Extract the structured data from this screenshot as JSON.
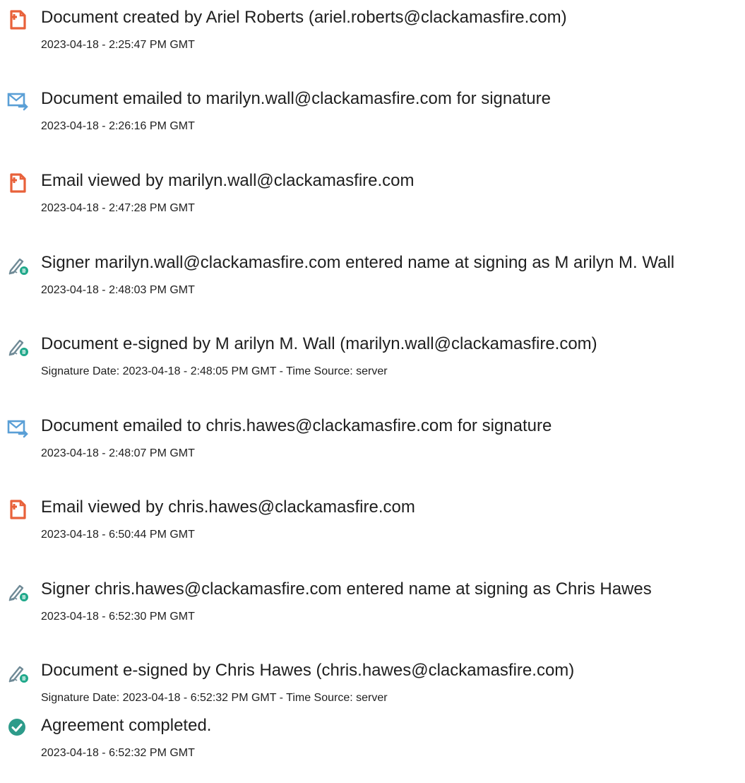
{
  "events": [
    {
      "icon": "document-created-icon",
      "title": "Document created by Ariel Roberts (ariel.roberts@clackamasfire.com)",
      "time": "2023-04-18 - 2:25:47 PM GMT"
    },
    {
      "icon": "email-sent-icon",
      "title": "Document emailed to marilyn.wall@clackamasfire.com for signature",
      "time": "2023-04-18 - 2:26:16 PM GMT"
    },
    {
      "icon": "document-viewed-icon",
      "title": "Email viewed by marilyn.wall@clackamasfire.com",
      "time": "2023-04-18 - 2:47:28 PM GMT"
    },
    {
      "icon": "esign-pen-icon",
      "title": "Signer marilyn.wall@clackamasfire.com entered name at signing as M arilyn M. Wall",
      "time": "2023-04-18 - 2:48:03 PM GMT"
    },
    {
      "icon": "esign-pen-icon",
      "title": "Document e-signed by M arilyn M. Wall (marilyn.wall@clackamasfire.com)",
      "time": "Signature Date: 2023-04-18 - 2:48:05 PM GMT - Time Source: server"
    },
    {
      "icon": "email-sent-icon",
      "title": "Document emailed to chris.hawes@clackamasfire.com for signature",
      "time": "2023-04-18 - 2:48:07 PM GMT"
    },
    {
      "icon": "document-viewed-icon",
      "title": "Email viewed by chris.hawes@clackamasfire.com",
      "time": "2023-04-18 - 6:50:44 PM GMT"
    },
    {
      "icon": "esign-pen-icon",
      "title": "Signer chris.hawes@clackamasfire.com entered name at signing as Chris Hawes",
      "time": "2023-04-18 - 6:52:30 PM GMT"
    },
    {
      "icon": "esign-pen-icon",
      "title": "Document e-signed by Chris Hawes (chris.hawes@clackamasfire.com)",
      "time": "Signature Date: 2023-04-18 - 6:52:32 PM GMT - Time Source: server"
    },
    {
      "icon": "check-circle-icon",
      "title": "Agreement completed.",
      "time": "2023-04-18 - 6:52:32 PM GMT"
    }
  ],
  "colors": {
    "document_icon": "#e8613a",
    "email_icon": "#5a9fd6",
    "pen_icon": "#6f8a96",
    "esign_badge": "#1fa88a",
    "check_icon": "#2d9b8a"
  }
}
